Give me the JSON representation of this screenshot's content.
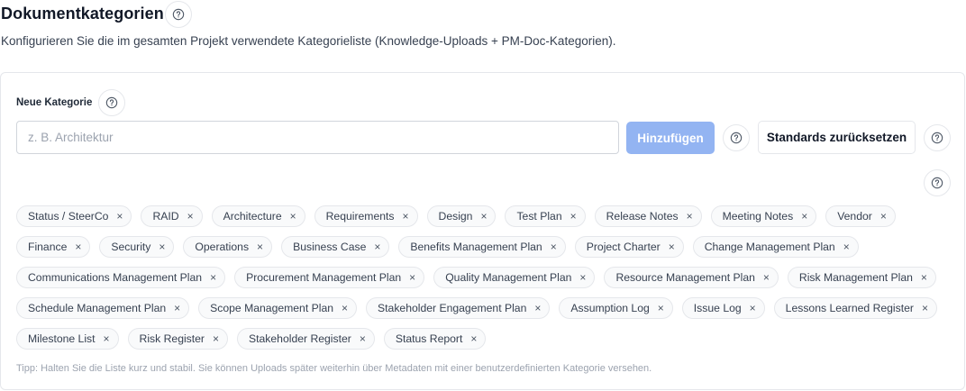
{
  "header": {
    "title": "Dokumentkategorien",
    "subtitle": "Konfigurieren Sie die im gesamten Projekt verwendete Kategorieliste (Knowledge-Uploads + PM-Doc-Kategorien)."
  },
  "form": {
    "label": "Neue Kategorie",
    "input_value": "",
    "placeholder": "z. B. Architektur",
    "add_label": "Hinzufügen",
    "reset_label": "Standards zurücksetzen"
  },
  "icons": {
    "help": "help-circle-icon",
    "remove": "close-icon"
  },
  "colors": {
    "primary_disabled": "#93b4f2",
    "chip_bg": "#f9fafb",
    "border": "#e5e7eb"
  },
  "categories": [
    "Status / SteerCo",
    "RAID",
    "Architecture",
    "Requirements",
    "Design",
    "Test Plan",
    "Release Notes",
    "Meeting Notes",
    "Vendor",
    "Finance",
    "Security",
    "Operations",
    "Business Case",
    "Benefits Management Plan",
    "Project Charter",
    "Change Management Plan",
    "Communications Management Plan",
    "Procurement Management Plan",
    "Quality Management Plan",
    "Resource Management Plan",
    "Risk Management Plan",
    "Schedule Management Plan",
    "Scope Management Plan",
    "Stakeholder Engagement Plan",
    "Assumption Log",
    "Issue Log",
    "Lessons Learned Register",
    "Milestone List",
    "Risk Register",
    "Stakeholder Register",
    "Status Report"
  ],
  "remove_glyph": "×",
  "tip": "Tipp: Halten Sie die Liste kurz und stabil. Sie können Uploads später weiterhin über Metadaten mit einer benutzerdefinierten Kategorie versehen."
}
